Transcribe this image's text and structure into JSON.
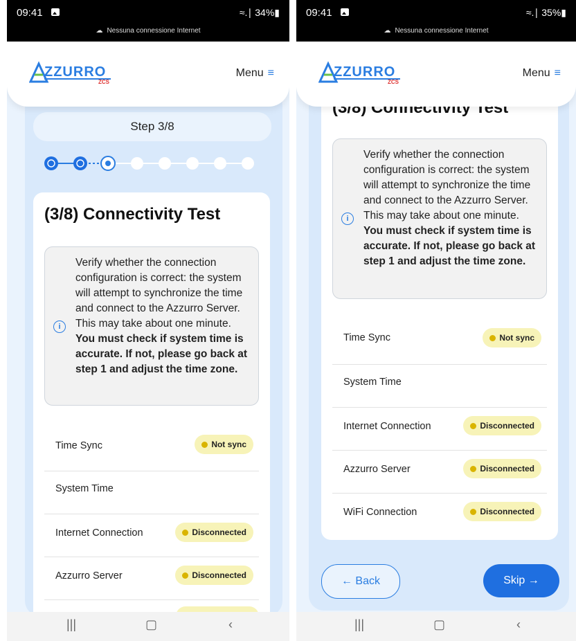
{
  "screens": [
    {
      "status": {
        "time": "09:41",
        "right": "⁕.∣ 34%",
        "network": "Nessuna connessione Internet"
      },
      "header": {
        "logo_text": "AZZURRO",
        "logo_sub": "ZCS",
        "menu_label": "Menu"
      },
      "step_label": "Step 3/8",
      "title": "(3/8) Connectivity Test",
      "info": {
        "text": "Verify whether the connection configuration is correct: the system will attempt to synchronize the time and connect to the Azzurro Server. This may take about one minute.",
        "bold": "You must check if system time is accurate. If not, please go back at step 1 and adjust the time zone."
      },
      "rows": [
        {
          "label": "Time Sync",
          "badge": "Not sync"
        },
        {
          "label": "System Time",
          "badge": ""
        },
        {
          "label": "Internet Connection",
          "badge": "Disconnected"
        },
        {
          "label": "Azzurro Server",
          "badge": "Disconnected"
        }
      ]
    },
    {
      "status": {
        "time": "09:41",
        "right": "⁕.∣ 35%",
        "network": "Nessuna connessione Internet"
      },
      "header": {
        "logo_text": "AZZURRO",
        "logo_sub": "ZCS",
        "menu_label": "Menu"
      },
      "title": "(3/8) Connectivity Test",
      "info": {
        "text": "Verify whether the connection configuration is correct: the system will attempt to synchronize the time and connect to the Azzurro Server. This may take about one minute.",
        "bold": "You must check if system time is accurate. If not, please go back at step 1 and adjust the time zone."
      },
      "rows": [
        {
          "label": "Time Sync",
          "badge": "Not sync"
        },
        {
          "label": "System Time",
          "badge": ""
        },
        {
          "label": "Internet Connection",
          "badge": "Disconnected"
        },
        {
          "label": "Azzurro Server",
          "badge": "Disconnected"
        },
        {
          "label": "WiFi Connection",
          "badge": "Disconnected"
        }
      ],
      "buttons": {
        "back": "← Back",
        "skip": "Skip →"
      }
    }
  ],
  "colors": {
    "accent": "#2a7de1",
    "badge_bg": "#f7f3b8",
    "badge_dot": "#d9b400",
    "panel": "#d9e9fb"
  },
  "icons": {
    "info": "info-icon",
    "menu": "hamburger-icon"
  }
}
